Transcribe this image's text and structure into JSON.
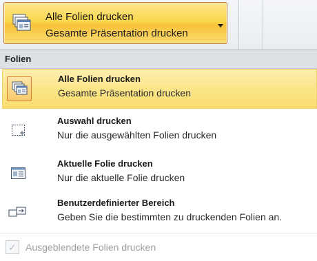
{
  "dropdown": {
    "title": "Alle Folien drucken",
    "subtitle": "Gesamte Präsentation drucken",
    "icon": "slides-stack-icon"
  },
  "menu": {
    "section_title": "Folien",
    "items": [
      {
        "title": "Alle Folien drucken",
        "description": "Gesamte Präsentation drucken",
        "icon": "slides-stack-icon",
        "selected": true
      },
      {
        "title": "Auswahl drucken",
        "description": "Nur die ausgewählten Folien drucken",
        "icon": "selection-icon",
        "selected": false
      },
      {
        "title": "Aktuelle Folie drucken",
        "description": "Nur die aktuelle Folie drucken",
        "icon": "single-slide-icon",
        "selected": false
      },
      {
        "title": "Benutzerdefinierter Bereich",
        "description": "Geben Sie die bestimmten zu druckenden Folien an.",
        "icon": "custom-range-icon",
        "selected": false
      }
    ],
    "footer": {
      "label": "Ausgeblendete Folien drucken",
      "checked": true,
      "enabled": false
    }
  },
  "colors": {
    "selected_fill": "#fbe58a",
    "selected_border": "#d9822d",
    "header_fill": "#dde1e6"
  }
}
